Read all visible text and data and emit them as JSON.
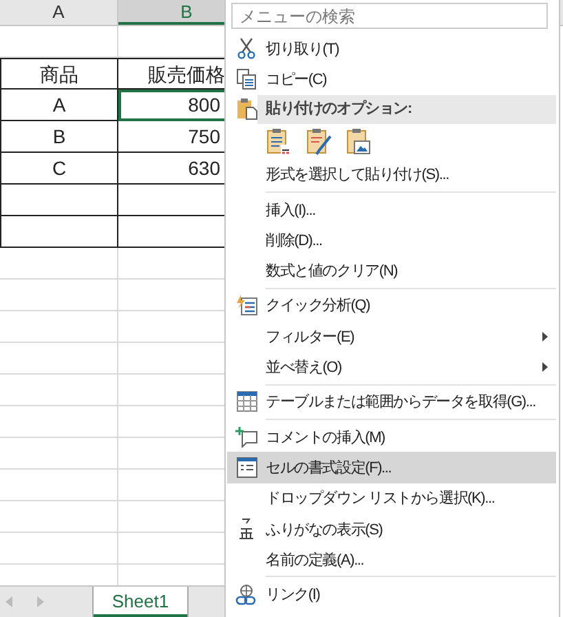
{
  "sheet": {
    "columns": [
      {
        "label": "A",
        "selected": false
      },
      {
        "label": "B",
        "selected": true
      }
    ],
    "table": {
      "header": [
        "商品",
        "販売価格"
      ],
      "rows": [
        {
          "item": "A",
          "price": "800",
          "selected": true
        },
        {
          "item": "B",
          "price": "750",
          "selected": false
        },
        {
          "item": "C",
          "price": "630",
          "selected": false
        }
      ]
    },
    "tabs": [
      {
        "label": "Sheet1",
        "selected": true
      }
    ]
  },
  "menu": {
    "search": {
      "placeholder": "メニューの検索"
    },
    "items": [
      {
        "kind": "item",
        "label": "切り取り(T)",
        "selected": false
      },
      {
        "kind": "item",
        "label": "コピー(C)",
        "selected": false
      },
      {
        "kind": "header",
        "label": "貼り付けのオプション:"
      },
      {
        "kind": "paste-options"
      },
      {
        "kind": "item",
        "label": "形式を選択して貼り付け(S)...",
        "selected": false
      },
      {
        "kind": "divider"
      },
      {
        "kind": "item",
        "label": "挿入(I)...",
        "selected": false
      },
      {
        "kind": "item",
        "label": "削除(D)...",
        "selected": false
      },
      {
        "kind": "item",
        "label": "数式と値のクリア(N)",
        "selected": false
      },
      {
        "kind": "divider"
      },
      {
        "kind": "item",
        "label": "クイック分析(Q)",
        "selected": false
      },
      {
        "kind": "item",
        "label": "フィルター(E)",
        "selected": false,
        "submenu": true
      },
      {
        "kind": "item",
        "label": "並べ替え(O)",
        "selected": false,
        "submenu": true
      },
      {
        "kind": "divider"
      },
      {
        "kind": "item",
        "label": "テーブルまたは範囲からデータを取得(G)...",
        "selected": false
      },
      {
        "kind": "divider"
      },
      {
        "kind": "item",
        "label": "コメントの挿入(M)",
        "selected": false
      },
      {
        "kind": "item",
        "label": "セルの書式設定(F)...",
        "selected": true
      },
      {
        "kind": "item",
        "label": "ドロップダウン リストから選択(K)...",
        "selected": false
      },
      {
        "kind": "item",
        "label": "ふりがなの表示(S)",
        "selected": false
      },
      {
        "kind": "item",
        "label": "名前の定義(A)...",
        "selected": false
      },
      {
        "kind": "divider"
      },
      {
        "kind": "item",
        "label": "リンク(I)",
        "selected": false
      }
    ]
  }
}
